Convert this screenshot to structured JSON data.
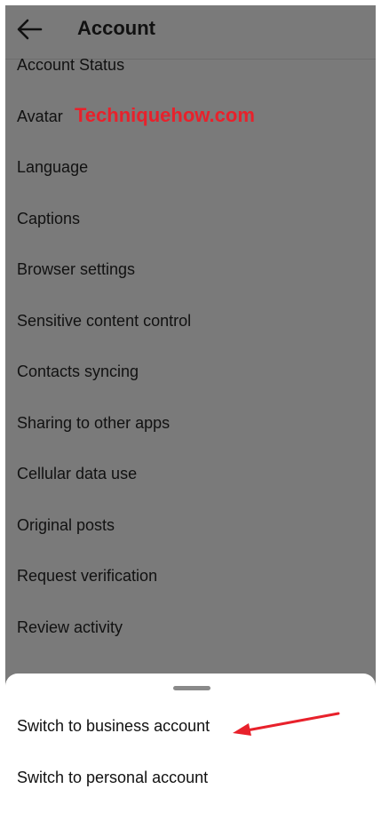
{
  "header": {
    "title": "Account",
    "back_icon": "arrow-left-icon"
  },
  "menu": {
    "items": [
      {
        "label": "Account Status"
      },
      {
        "label": "Avatar"
      },
      {
        "label": "Language"
      },
      {
        "label": "Captions"
      },
      {
        "label": "Browser settings"
      },
      {
        "label": "Sensitive content control"
      },
      {
        "label": "Contacts syncing"
      },
      {
        "label": "Sharing to other apps"
      },
      {
        "label": "Cellular data use"
      },
      {
        "label": "Original posts"
      },
      {
        "label": "Request verification"
      },
      {
        "label": "Review activity"
      }
    ]
  },
  "watermark": {
    "text": "Techniquehow.com",
    "color": "#e8212b"
  },
  "sheet": {
    "items": [
      {
        "label": "Switch to business account"
      },
      {
        "label": "Switch to personal account"
      }
    ]
  },
  "annotation": {
    "arrow_color": "#e8212b",
    "icon": "red-arrow-icon"
  },
  "colors": {
    "overlay": "#7a7a7a",
    "sheet_background": "#ffffff",
    "text": "#111111"
  }
}
